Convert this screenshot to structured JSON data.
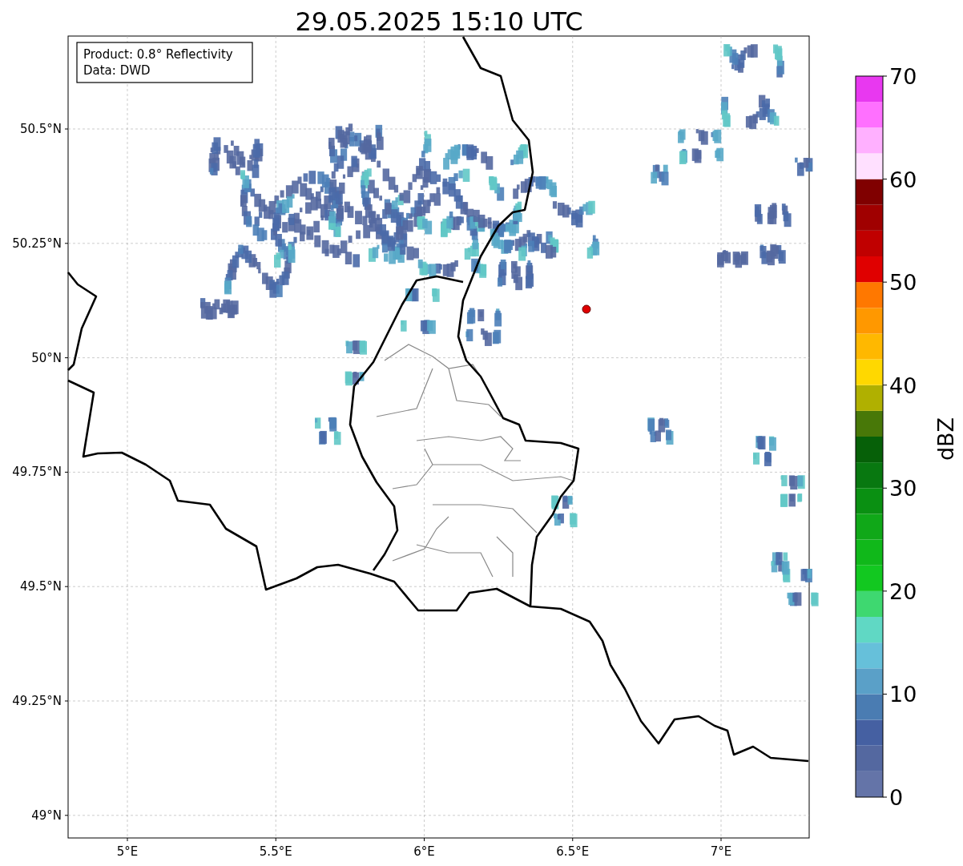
{
  "title": "29.05.2025 15:10 UTC",
  "info_box": [
    "Product: 0.8° Reflectivity",
    "Data: DWD"
  ],
  "map": {
    "x_ticks": [
      "5°E",
      "5.5°E",
      "6°E",
      "6.5°E",
      "7°E"
    ],
    "y_ticks": [
      "50.5°N",
      "50.25°N",
      "50°N",
      "49.75°N",
      "49.5°N",
      "49.25°N",
      "49°N"
    ]
  },
  "colorbar": {
    "label": "dBZ",
    "ticks": [
      "70",
      "60",
      "50",
      "40",
      "30",
      "20",
      "10",
      "0"
    ],
    "segments": [
      {
        "color": "#6474a8"
      },
      {
        "color": "#5468a0"
      },
      {
        "color": "#4560a2"
      },
      {
        "color": "#4a7cb2"
      },
      {
        "color": "#5aa0c8"
      },
      {
        "color": "#66c0da"
      },
      {
        "color": "#60d8c4"
      },
      {
        "color": "#3ed870"
      },
      {
        "color": "#12c820"
      },
      {
        "color": "#10b81a"
      },
      {
        "color": "#10a818"
      },
      {
        "color": "#0a9012"
      },
      {
        "color": "#087810"
      },
      {
        "color": "#066008"
      },
      {
        "color": "#487808"
      },
      {
        "color": "#b0b000"
      },
      {
        "color": "#ffd800"
      },
      {
        "color": "#ffb800"
      },
      {
        "color": "#ff9800"
      },
      {
        "color": "#ff7800"
      },
      {
        "color": "#e00000"
      },
      {
        "color": "#c00000"
      },
      {
        "color": "#a00000"
      },
      {
        "color": "#800000"
      },
      {
        "color": "#ffe0ff"
      },
      {
        "color": "#ffb0ff"
      },
      {
        "color": "#ff70ff"
      },
      {
        "color": "#e838f0"
      }
    ]
  }
}
